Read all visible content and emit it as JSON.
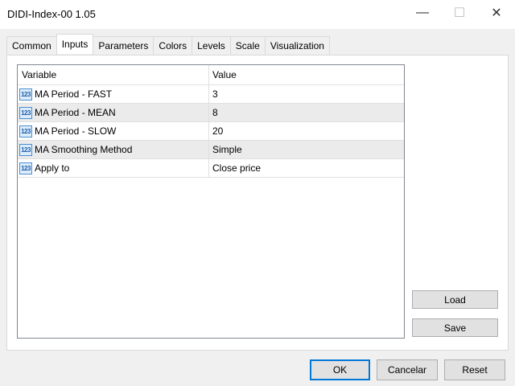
{
  "window": {
    "title": "DIDI-Index-00 1.05",
    "minimize": "—",
    "maximize": "☐",
    "close": "✕"
  },
  "tabs": [
    {
      "label": "Common"
    },
    {
      "label": "Inputs",
      "active": true
    },
    {
      "label": "Parameters"
    },
    {
      "label": "Colors"
    },
    {
      "label": "Levels"
    },
    {
      "label": "Scale"
    },
    {
      "label": "Visualization"
    }
  ],
  "table": {
    "headers": {
      "variable": "Variable",
      "value": "Value"
    },
    "rows": [
      {
        "icon": "123",
        "variable": "MA Period - FAST",
        "value": "3"
      },
      {
        "icon": "123",
        "variable": "MA Period - MEAN",
        "value": "8"
      },
      {
        "icon": "123",
        "variable": "MA Period - SLOW",
        "value": "20"
      },
      {
        "icon": "123",
        "variable": "MA Smoothing Method",
        "value": "Simple"
      },
      {
        "icon": "123",
        "variable": "Apply to",
        "value": "Close price"
      }
    ]
  },
  "side_buttons": {
    "load": "Load",
    "save": "Save"
  },
  "footer": {
    "ok": "OK",
    "cancel": "Cancelar",
    "reset": "Reset"
  }
}
